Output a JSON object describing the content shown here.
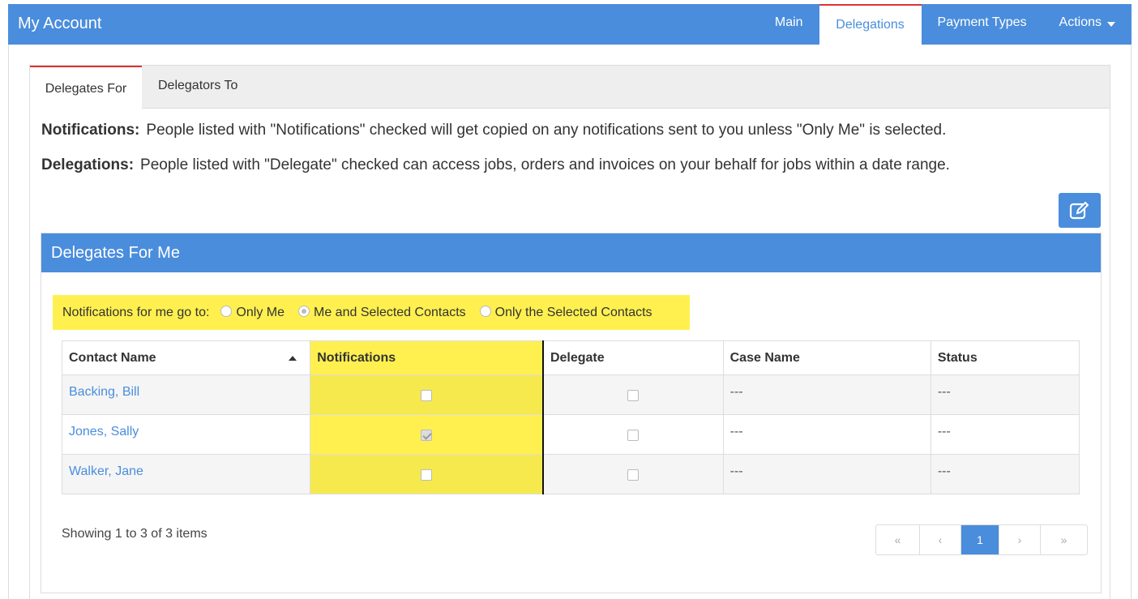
{
  "header": {
    "title": "My Account",
    "nav": [
      {
        "label": "Main",
        "active": false
      },
      {
        "label": "Delegations",
        "active": true
      },
      {
        "label": "Payment Types",
        "active": false
      },
      {
        "label": "Actions",
        "active": false
      }
    ]
  },
  "subtabs": [
    {
      "label": "Delegates For",
      "active": true
    },
    {
      "label": "Delegators To",
      "active": false
    }
  ],
  "info": {
    "notifications_label": "Notifications:",
    "notifications_text": "People listed with \"Notifications\" checked will get copied on any notifications sent to you unless \"Only Me\" is selected.",
    "delegations_label": "Delegations:",
    "delegations_text": "People listed with \"Delegate\" checked can access jobs, orders and invoices on your behalf for jobs within a date range."
  },
  "box": {
    "title": "Delegates For Me",
    "notify_label": "Notifications for me go to:",
    "notify_options": [
      {
        "label": "Only Me",
        "checked": false
      },
      {
        "label": "Me and Selected Contacts",
        "checked": true
      },
      {
        "label": "Only the Selected Contacts",
        "checked": false
      }
    ]
  },
  "table": {
    "columns": [
      "Contact Name",
      "Notifications",
      "Delegate",
      "Case Name",
      "Status"
    ],
    "rows": [
      {
        "name": "Backing, Bill",
        "notifications": false,
        "delegate": false,
        "case_name": "---",
        "status": "---"
      },
      {
        "name": "Jones, Sally",
        "notifications": true,
        "delegate": false,
        "case_name": "---",
        "status": "---"
      },
      {
        "name": "Walker, Jane",
        "notifications": false,
        "delegate": false,
        "case_name": "---",
        "status": "---"
      }
    ]
  },
  "footer": {
    "showing": "Showing 1 to 3 of 3 items",
    "pager": [
      "«",
      "‹",
      "1",
      "›",
      "»"
    ],
    "current_page": "1"
  },
  "colors": {
    "accent": "#4a8ddc",
    "highlight": "#fff04f",
    "active_tab_border": "#dd3333"
  }
}
